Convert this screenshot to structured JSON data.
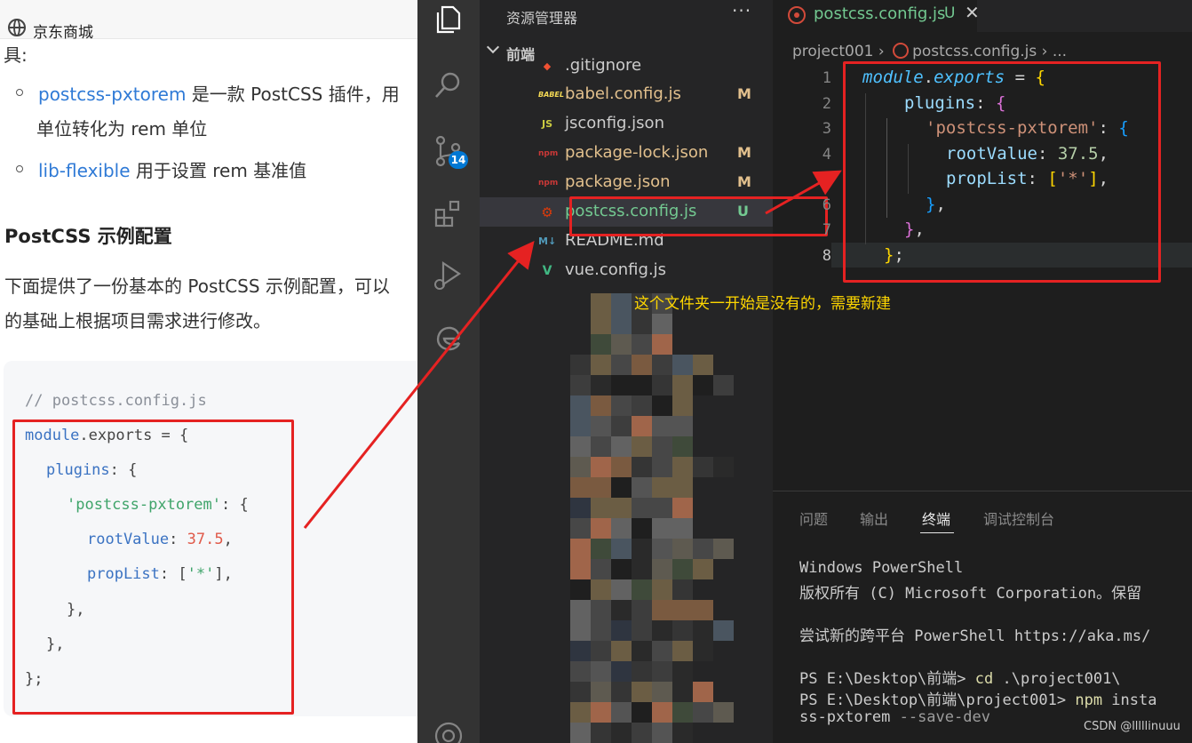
{
  "doc": {
    "tab_title": "京东商城",
    "intro_tail": "具:",
    "list": [
      {
        "link": "postcss-pxtorem",
        "text": " 是一款 PostCSS 插件，用"
      },
      {
        "continuation": "单位转化为 rem 单位"
      },
      {
        "link": "lib-flexible",
        "text": " 用于设置 rem 基准值"
      }
    ],
    "heading": "PostCSS 示例配置",
    "para_line1": "下面提供了一份基本的 PostCSS 示例配置，可以",
    "para_line2": "的基础上根据项目需求进行修改。",
    "code": {
      "comment": "// postcss.config.js",
      "l1_obj": "module",
      "l1_rest": ".exports = {",
      "l2_key": "plugins",
      "l2_rest": ": {",
      "l3_str": "'postcss-pxtorem'",
      "l3_rest": ": {",
      "l4_key": "rootValue",
      "l4_colon": ": ",
      "l4_num": "37.5",
      "l4_comma": ",",
      "l5_key": "propList",
      "l5_open": ": [",
      "l5_str": "'*'",
      "l5_close": "],",
      "l6": "},",
      "l7": "},",
      "l8": "};"
    }
  },
  "vscode": {
    "explorer_title": "资源管理器",
    "more_actions": "···",
    "scm_badge": "14",
    "folder": "前端",
    "files": [
      {
        "icon": "git",
        "icon_text": "◆",
        "icon_color": "#f05133",
        "name": ".gitignore",
        "status": "",
        "state": "normal"
      },
      {
        "icon": "babel",
        "icon_text": "BABEL",
        "icon_color": "#f5da55",
        "name": "babel.config.js",
        "status": "M",
        "state": "mod"
      },
      {
        "icon": "js",
        "icon_text": "JS",
        "icon_color": "#cbcb41",
        "name": "jsconfig.json",
        "status": "",
        "state": "normal"
      },
      {
        "icon": "npm",
        "icon_text": "npm",
        "icon_color": "#cb3837",
        "name": "package-lock.json",
        "status": "M",
        "state": "mod"
      },
      {
        "icon": "npm",
        "icon_text": "npm",
        "icon_color": "#cb3837",
        "name": "package.json",
        "status": "M",
        "state": "mod"
      },
      {
        "icon": "postcss",
        "icon_text": "⚙",
        "icon_color": "#dd3a0a",
        "name": "postcss.config.js",
        "status": "U",
        "state": "new"
      },
      {
        "icon": "markdown",
        "icon_text": "M↓",
        "icon_color": "#519aba",
        "name": "README.md",
        "status": "",
        "state": "normal"
      },
      {
        "icon": "vue",
        "icon_text": "V",
        "icon_color": "#41b883",
        "name": "vue.config.js",
        "status": "",
        "state": "normal"
      }
    ],
    "tab": {
      "label": "postcss.config.js",
      "status": "U",
      "close": "✕"
    },
    "breadcrumb": {
      "folder": "project001",
      "sep": "›",
      "file": "postcss.config.js",
      "tail": "› ..."
    },
    "line_numbers": [
      "1",
      "2",
      "3",
      "4",
      "5",
      "6",
      "7",
      "8"
    ],
    "code": {
      "l1_obj": "module",
      "l1_dot": ".",
      "l1_exp": "exports",
      "l1_eq": " = ",
      "l1_brace": "{",
      "l2_key": "plugins",
      "l2_colon": ": ",
      "l2_brace": "{",
      "l3_str": "'postcss-pxtorem'",
      "l3_colon": ": ",
      "l3_brace": "{",
      "l4_key": "rootValue",
      "l4_colon": ": ",
      "l4_num": "37.5",
      "l4_comma": ",",
      "l5_key": "propList",
      "l5_colon": ": ",
      "l5_open": "[",
      "l5_str": "'*'",
      "l5_close": "]",
      "l5_comma": ",",
      "l6_brace": "}",
      "l6_comma": ",",
      "l7_brace": "}",
      "l7_comma": ",",
      "l8_brace": "}",
      "l8_semi": ";"
    },
    "annotation": "这个文件夹一开始是没有的，需要新建",
    "panel": {
      "tabs": [
        "问题",
        "输出",
        "终端",
        "调试控制台"
      ],
      "active_tab": "终端",
      "terminal": {
        "l1": "Windows PowerShell",
        "l2": "版权所有 (C) Microsoft Corporation。保留",
        "l3": "尝试新的跨平台 PowerShell https://aka.ms/",
        "l4_prompt": "PS E:\\Desktop\\前端> ",
        "l4_cmd": "cd",
        "l4_arg": " .\\project001\\",
        "l5_prompt": "PS E:\\Desktop\\前端\\project001> ",
        "l5_cmd": "npm",
        "l5_arg": " insta",
        "l6_arg": "ss-pxtorem",
        "l6_flag": " --save-dev"
      }
    },
    "watermark": "CSDN @lllllinuuu"
  },
  "colors": {
    "annotation_red": "#e52222",
    "vscode_bg": "#1e1e1e",
    "link_blue": "#2f7ad6",
    "untracked_green": "#73c991",
    "modified_yellow": "#e2c08d"
  }
}
